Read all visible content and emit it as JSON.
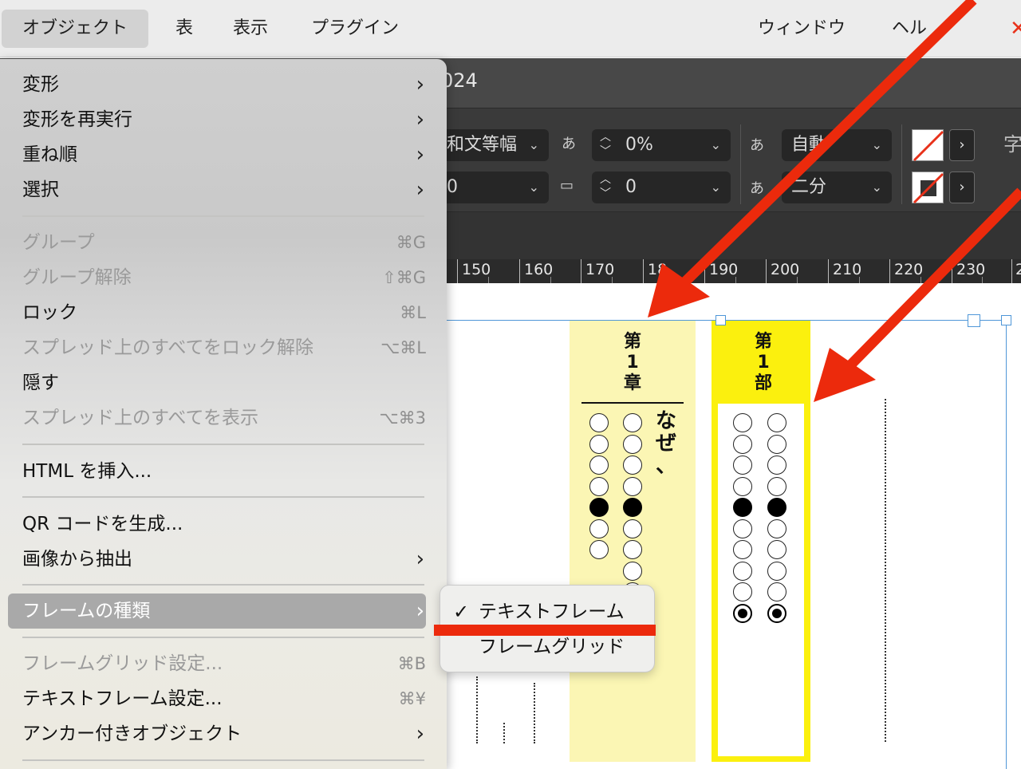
{
  "menubar": {
    "items": [
      "オブジェクト",
      "表",
      "表示",
      "プラグイン",
      "ウィンドウ",
      "ヘル"
    ]
  },
  "document": {
    "title_fragment": "024"
  },
  "controls": {
    "font_style": "和文等幅",
    "tracking_value": "0%",
    "auto_label": "自動",
    "second_field": "0",
    "second_value": "0",
    "nibun": "二分",
    "icon_aki": "あ",
    "ji_icon": "字"
  },
  "ruler": {
    "labels": [
      "150",
      "160",
      "170",
      "18",
      "190",
      "200",
      "210",
      "220",
      "230",
      "2"
    ]
  },
  "page": {
    "chapter": [
      "第",
      "1",
      "章"
    ],
    "part": [
      "第",
      "1",
      "部"
    ],
    "naze": [
      "な",
      "ぜ",
      "、"
    ]
  },
  "object_menu": {
    "items": [
      {
        "label": "変形",
        "submenu": true,
        "enabled": true
      },
      {
        "label": "変形を再実行",
        "submenu": true,
        "enabled": true
      },
      {
        "label": "重ね順",
        "submenu": true,
        "enabled": true
      },
      {
        "label": "選択",
        "submenu": true,
        "enabled": true
      },
      {
        "label": "グループ",
        "shortcut": "⌘G",
        "enabled": false
      },
      {
        "label": "グループ解除",
        "shortcut": "⇧⌘G",
        "enabled": false
      },
      {
        "label": "ロック",
        "shortcut": "⌘L",
        "enabled": true
      },
      {
        "label": "スプレッド上のすべてをロック解除",
        "shortcut": "⌥⌘L",
        "enabled": false
      },
      {
        "label": "隠す",
        "shortcut": "",
        "enabled": true
      },
      {
        "label": "スプレッド上のすべてを表示",
        "shortcut": "⌥⌘3",
        "enabled": false
      },
      {
        "label": "HTML を挿入...",
        "enabled": true
      },
      {
        "label": "QR コードを生成...",
        "enabled": true
      },
      {
        "label": "画像から抽出",
        "submenu": true,
        "enabled": true
      },
      {
        "label": "フレームの種類",
        "submenu": true,
        "enabled": true,
        "highlighted": true
      },
      {
        "label": "フレームグリッド設定...",
        "shortcut": "⌘B",
        "enabled": false
      },
      {
        "label": "テキストフレーム設定...",
        "shortcut": "⌘¥",
        "enabled": true
      },
      {
        "label": "アンカー付きオブジェクト",
        "submenu": true,
        "enabled": true
      }
    ]
  },
  "frame_type_submenu": {
    "items": [
      {
        "label": "テキストフレーム",
        "checked": true
      },
      {
        "label": "フレームグリッド",
        "checked": false
      }
    ],
    "check_glyph": "✓"
  },
  "icons": {
    "chevron": "›",
    "caret": "⌄",
    "red_x": "✕"
  },
  "colors": {
    "annotation_red": "#ec2a0c",
    "yellow": "#fbf00e",
    "light_yellow": "#fbf6b4"
  }
}
